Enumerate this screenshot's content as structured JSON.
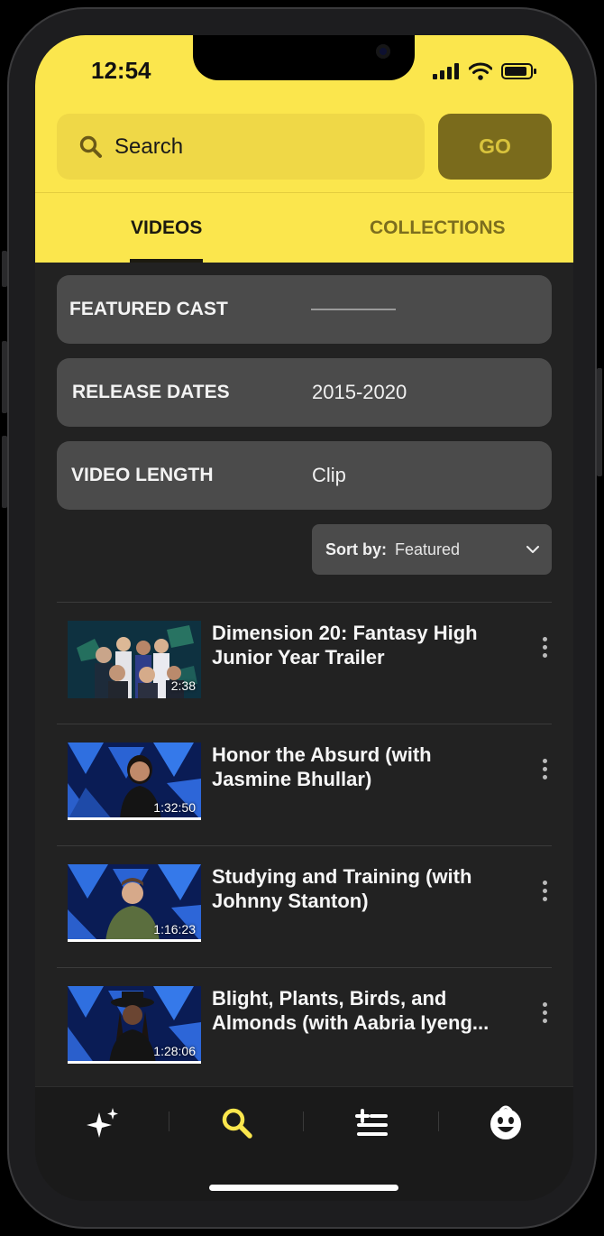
{
  "status_bar": {
    "time": "12:54"
  },
  "search": {
    "placeholder": "Search",
    "go_label": "GO"
  },
  "tabs": [
    {
      "label": "VIDEOS",
      "active": true
    },
    {
      "label": "COLLECTIONS",
      "active": false
    }
  ],
  "filters": {
    "featured_cast": {
      "label": "FEATURED CAST",
      "value": ""
    },
    "release_dates": {
      "label": "RELEASE DATES",
      "value": "2015-2020"
    },
    "video_length": {
      "label": "VIDEO LENGTH",
      "value": "Clip"
    }
  },
  "sort": {
    "label": "Sort by:",
    "value": "Featured"
  },
  "videos": [
    {
      "title": "Dimension 20: Fantasy High Junior Year Trailer",
      "duration": "2:38"
    },
    {
      "title": "Honor the Absurd (with Jasmine Bhullar)",
      "duration": "1:32:50"
    },
    {
      "title": "Studying and Training (with Johnny Stanton)",
      "duration": "1:16:23"
    },
    {
      "title": "Blight, Plants, Birds, and Almonds (with Aabria Iyeng...",
      "duration": "1:28:06"
    }
  ],
  "nav": [
    {
      "icon": "sparkles-icon"
    },
    {
      "icon": "search-icon",
      "active": true
    },
    {
      "icon": "queue-add-icon"
    },
    {
      "icon": "profile-face-icon"
    }
  ],
  "colors": {
    "brand_yellow": "#fbe64d",
    "go_button": "#7a6b1c",
    "background": "#222222"
  }
}
